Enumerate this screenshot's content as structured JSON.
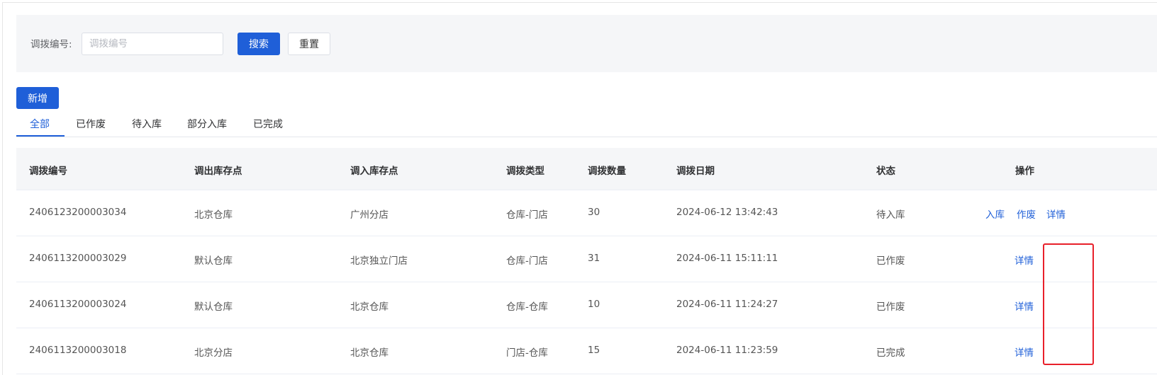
{
  "search": {
    "label": "调拨编号:",
    "placeholder": "调拨编号",
    "value": "",
    "search_button": "搜索",
    "reset_button": "重置"
  },
  "toolbar": {
    "add_button": "新增"
  },
  "tabs": [
    {
      "label": "全部",
      "active": true
    },
    {
      "label": "已作废",
      "active": false
    },
    {
      "label": "待入库",
      "active": false
    },
    {
      "label": "部分入库",
      "active": false
    },
    {
      "label": "已完成",
      "active": false
    }
  ],
  "table": {
    "columns": [
      "调拨编号",
      "调出库存点",
      "调入库存点",
      "调拨类型",
      "调拨数量",
      "调拨日期",
      "状态",
      "操作"
    ],
    "rows": [
      {
        "id": "2406123200003034",
        "from": "北京仓库",
        "to": "广州分店",
        "type": "仓库-门店",
        "qty": "30",
        "date": "2024-06-12 13:42:43",
        "status": "待入库",
        "actions": [
          "入库",
          "作废",
          "详情"
        ]
      },
      {
        "id": "2406113200003029",
        "from": "默认仓库",
        "to": "北京独立门店",
        "type": "仓库-门店",
        "qty": "31",
        "date": "2024-06-11 15:11:11",
        "status": "已作废",
        "actions": [
          "详情"
        ]
      },
      {
        "id": "2406113200003024",
        "from": "默认仓库",
        "to": "北京仓库",
        "type": "仓库-仓库",
        "qty": "10",
        "date": "2024-06-11 11:24:27",
        "status": "已作废",
        "actions": [
          "详情"
        ]
      },
      {
        "id": "2406113200003018",
        "from": "北京分店",
        "to": "北京仓库",
        "type": "门店-仓库",
        "qty": "15",
        "date": "2024-06-11 11:23:59",
        "status": "已完成",
        "actions": [
          "详情"
        ]
      }
    ]
  },
  "colors": {
    "primary": "#1f5fd8",
    "highlight": "#e8202a",
    "panel_bg": "#f5f6f8"
  }
}
